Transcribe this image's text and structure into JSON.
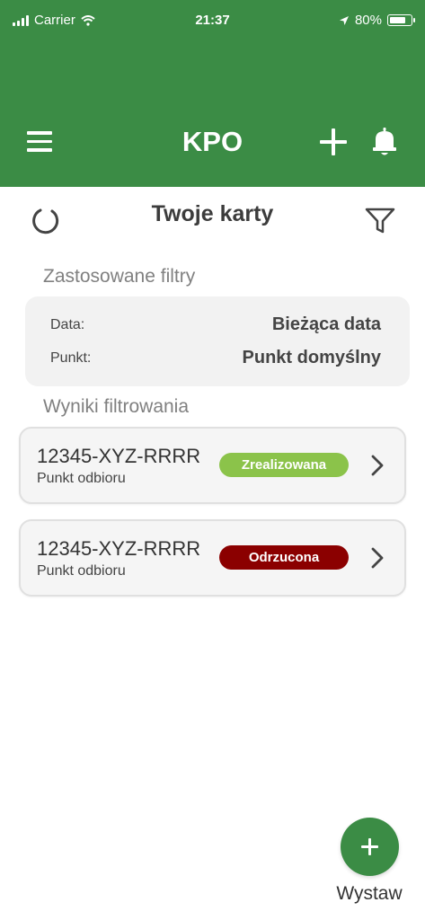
{
  "status_bar": {
    "carrier": "Carrier",
    "time": "21:37",
    "battery": "80%",
    "battery_level": 0.8
  },
  "header": {
    "title": "KPO",
    "menu_icon": "hamburger-menu-icon",
    "add_icon": "plus-icon",
    "notifications_icon": "bell-icon",
    "color": "#3b8c45"
  },
  "page": {
    "title": "Twoje karty",
    "refresh_icon": "refresh-icon",
    "filter_icon": "funnel-icon"
  },
  "filters": {
    "section_label": "Zastosowane filtry",
    "items": [
      {
        "key": "Data:",
        "value": "Bieżąca data"
      },
      {
        "key": "Punkt:",
        "value": "Punkt domyślny"
      }
    ]
  },
  "results": {
    "section_label": "Wyniki filtrowania",
    "cards": [
      {
        "id": "12345-XYZ-RRRR",
        "subtitle": "Punkt odbioru",
        "status": "Zrealizowana",
        "status_color": "#8bc34a"
      },
      {
        "id": "12345-XYZ-RRRR",
        "subtitle": "Punkt odbioru",
        "status": "Odrzucona",
        "status_color": "#8b0000"
      }
    ]
  },
  "fab": {
    "symbol": "+",
    "label": "Wystaw"
  }
}
